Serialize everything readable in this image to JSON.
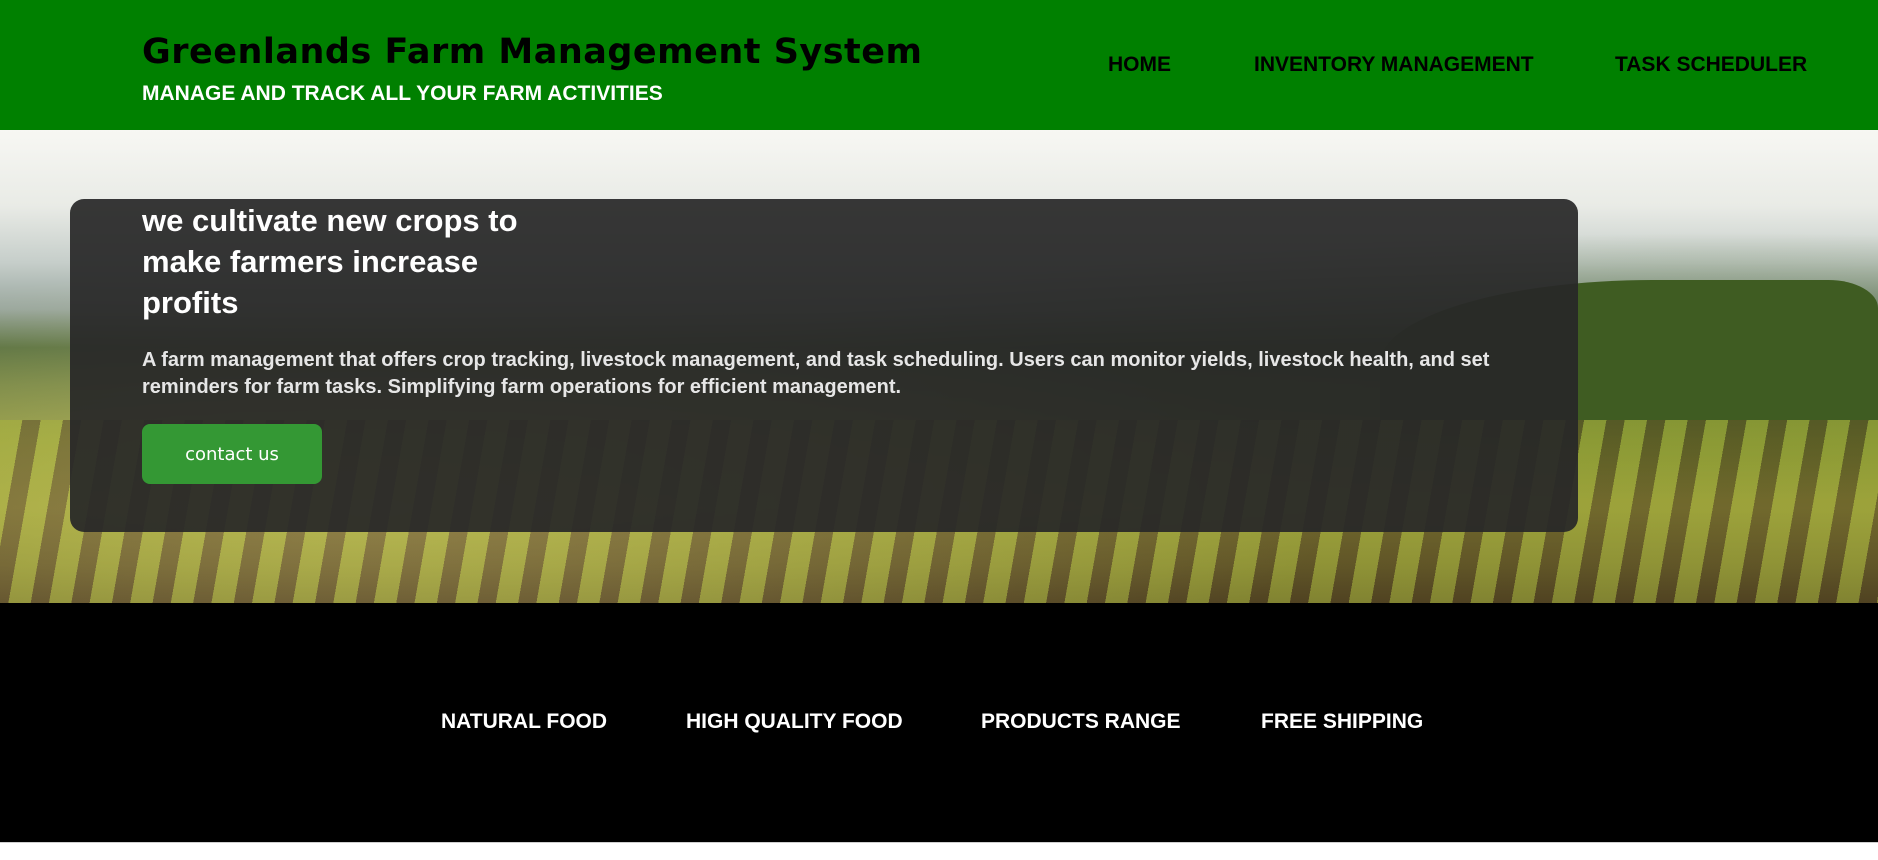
{
  "header": {
    "title": "Greenlands Farm Management System",
    "tagline": "MANAGE AND TRACK ALL YOUR FARM ACTIVITIES",
    "nav": [
      {
        "label": "HOME"
      },
      {
        "label": "INVENTORY MANAGEMENT"
      },
      {
        "label": "TASK SCHEDULER"
      }
    ]
  },
  "hero": {
    "headline": "we cultivate new crops to make farmers increase profits",
    "description": "A farm management that offers crop tracking, livestock management, and task scheduling. Users can monitor yields, livestock health, and set reminders for farm tasks. Simplifying farm operations for efficient management.",
    "cta_label": "contact us"
  },
  "features": [
    {
      "label": "NATURAL FOOD"
    },
    {
      "label": "HIGH QUALITY FOOD"
    },
    {
      "label": "PRODUCTS RANGE"
    },
    {
      "label": "FREE SHIPPING"
    }
  ],
  "colors": {
    "header_bg": "#008000",
    "button_bg": "#349834",
    "panel_bg": "#282828",
    "band_bg": "#000000"
  }
}
